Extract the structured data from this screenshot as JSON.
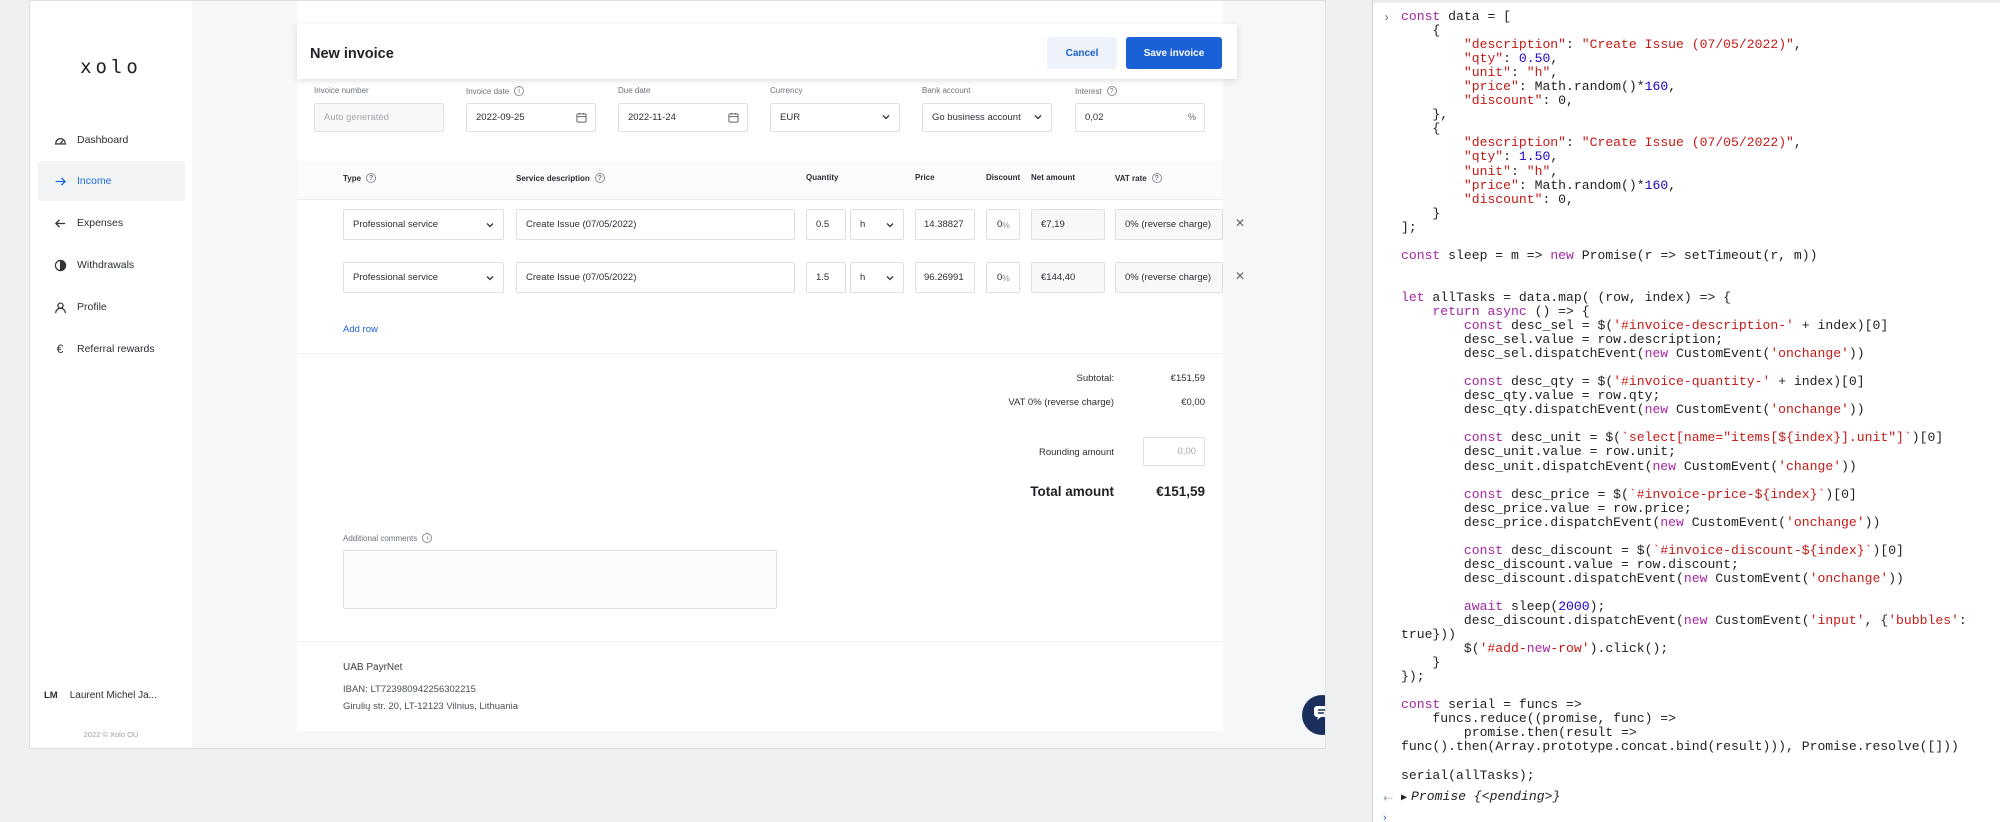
{
  "sidebar": {
    "logo": "xolo",
    "items": [
      {
        "label": "Dashboard",
        "icon": "dashboard-gauge-icon"
      },
      {
        "label": "Income",
        "icon": "arrow-right-icon"
      },
      {
        "label": "Expenses",
        "icon": "arrow-left-icon"
      },
      {
        "label": "Withdrawals",
        "icon": "withdrawals-icon"
      },
      {
        "label": "Profile",
        "icon": "user-icon"
      },
      {
        "label": "Referral rewards",
        "icon": "euro-icon"
      }
    ],
    "user": {
      "initials": "LM",
      "name": "Laurent Michel Ja..."
    },
    "copyright": "2022 © Xolo OÜ"
  },
  "header": {
    "title": "New invoice",
    "cancel_label": "Cancel",
    "save_label": "Save invoice"
  },
  "meta": {
    "invoice_number": {
      "label": "Invoice number",
      "placeholder": "Auto generated"
    },
    "invoice_date": {
      "label": "Invoice date",
      "value": "2022-09-25"
    },
    "due_date": {
      "label": "Due date",
      "value": "2022-11-24"
    },
    "currency": {
      "label": "Currency",
      "value": "EUR"
    },
    "bank_account": {
      "label": "Bank account",
      "value": "Go business account"
    },
    "interest": {
      "label": "Interest",
      "value": "0,02",
      "unit": "%"
    }
  },
  "table": {
    "headers": {
      "type": "Type",
      "description": "Service description",
      "quantity": "Quantity",
      "price": "Price",
      "discount": "Discount",
      "net": "Net amount",
      "vat": "VAT rate"
    },
    "rows": [
      {
        "type": "Professional service",
        "description": "Create Issue (07/05/2022)",
        "qty": "0.5",
        "unit": "h",
        "price": "14.38827",
        "discount": "0",
        "discount_unit": "%",
        "net": "€7,19",
        "vat": "0% (reverse charge)"
      },
      {
        "type": "Professional service",
        "description": "Create Issue (07/05/2022)",
        "qty": "1.5",
        "unit": "h",
        "price": "96.26991",
        "discount": "0",
        "discount_unit": "%",
        "net": "€144,40",
        "vat": "0% (reverse charge)"
      }
    ],
    "add_row": "Add row"
  },
  "totals": {
    "subtotal_label": "Subtotal:",
    "subtotal": "€151,59",
    "vat_label": "VAT 0% (reverse charge)",
    "vat": "€0,00",
    "rounding_label": "Rounding amount",
    "rounding_placeholder": "0,00",
    "total_label": "Total amount",
    "total": "€151,59"
  },
  "comments": {
    "label": "Additional comments"
  },
  "footer": {
    "company": "UAB PayrNet",
    "iban": "IBAN: LT723980942256302215",
    "address": "Girulių str. 20, LT-12123 Vilnius, Lithuania"
  },
  "help_label": "?",
  "console": {
    "code_lines": [
      "const data = [",
      "    {",
      "        \"description\": \"Create Issue (07/05/2022)\",",
      "        \"qty\": 0.50,",
      "        \"unit\": \"h\",",
      "        \"price\": Math.random()*160,",
      "        \"discount\": 0,",
      "    },",
      "    {",
      "        \"description\": \"Create Issue (07/05/2022)\",",
      "        \"qty\": 1.50,",
      "        \"unit\": \"h\",",
      "        \"price\": Math.random()*160,",
      "        \"discount\": 0,",
      "    }",
      "];",
      "",
      "const sleep = m => new Promise(r => setTimeout(r, m))",
      "",
      "",
      "let allTasks = data.map( (row, index) => {",
      "    return async () => {",
      "        const desc_sel = $('#invoice-description-' + index)[0]",
      "        desc_sel.value = row.description;",
      "        desc_sel.dispatchEvent(new CustomEvent('onchange'))",
      "",
      "        const desc_qty = $('#invoice-quantity-' + index)[0]",
      "        desc_qty.value = row.qty;",
      "        desc_qty.dispatchEvent(new CustomEvent('onchange'))",
      "",
      "        const desc_unit = $(`select[name=\"items[${index}].unit\"]`)[0]",
      "        desc_unit.value = row.unit;",
      "        desc_unit.dispatchEvent(new CustomEvent('change'))",
      "",
      "        const desc_price = $(`#invoice-price-${index}`)[0]",
      "        desc_price.value = row.price;",
      "        desc_price.dispatchEvent(new CustomEvent('onchange'))",
      "",
      "        const desc_discount = $(`#invoice-discount-${index}`)[0]",
      "        desc_discount.value = row.discount;",
      "        desc_discount.dispatchEvent(new CustomEvent('onchange'))",
      "",
      "        await sleep(2000);",
      "        desc_discount.dispatchEvent(new CustomEvent('input', {'bubbles':",
      "true}))",
      "        $('#add-new-row').click();",
      "    }",
      "});",
      "",
      "const serial = funcs =>",
      "    funcs.reduce((promise, func) =>",
      "        promise.then(result =>",
      "func().then(Array.prototype.concat.bind(result))), Promise.resolve([]))",
      "",
      "serial(allTasks);"
    ],
    "result": "Promise {<pending>}"
  }
}
